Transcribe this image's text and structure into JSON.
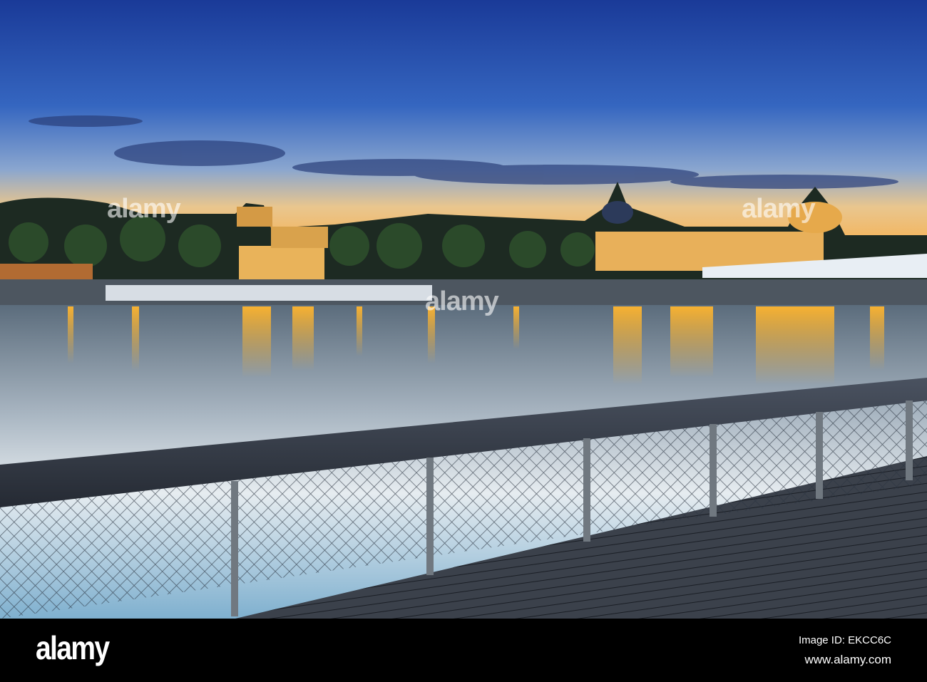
{
  "photo": {
    "subject": "Lyon riverside at dusk",
    "colors": {
      "sky_top": "#1b3d9c",
      "sky_mid": "#3f6fc4",
      "horizon": "#f0c27a",
      "water": "#cfdbe6",
      "lights": "#ffb52e",
      "wood": "#3a4250"
    }
  },
  "watermarks": [
    "alamy",
    "alamy",
    "alamy"
  ],
  "footer": {
    "logo": "alamy",
    "image_id": "Image ID: EKCC6C",
    "website": "www.alamy.com"
  }
}
